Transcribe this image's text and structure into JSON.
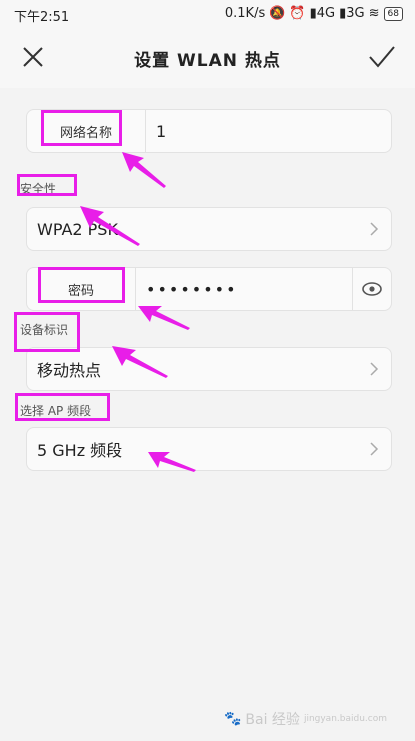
{
  "status_bar": {
    "time": "下午2:51",
    "network_speed": "0.1K/s",
    "signal_4g": "4G",
    "signal_3g": "3G",
    "battery": "68"
  },
  "title_bar": {
    "title": "设置 WLAN 热点"
  },
  "form": {
    "network_name_label": "网络名称",
    "network_name_value": "1",
    "security_section": "安全性",
    "security_value": "WPA2 PSK",
    "password_label": "密码",
    "password_value": "••••••••",
    "device_id_section": "设备标识",
    "device_id_value": "移动热点",
    "band_section": "选择 AP 频段",
    "band_value": "5 GHz 频段"
  },
  "watermark": {
    "text": "Bai 经验",
    "sub": "jingyan.baidu.com"
  },
  "colors": {
    "annotation": "#e81ee8",
    "background": "#f3f3f3"
  }
}
